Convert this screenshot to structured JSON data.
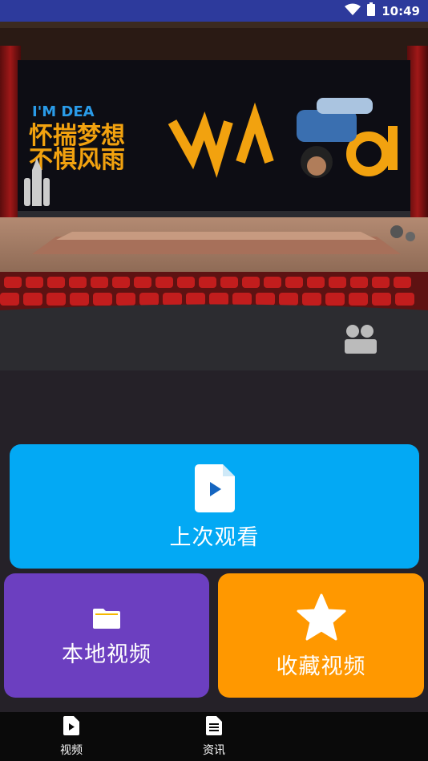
{
  "status_bar": {
    "time": "10:49"
  },
  "banner": {
    "headline_en": "I'M DEA",
    "headline_cn_line1": "怀揣梦想",
    "headline_cn_line2": "不惧风雨"
  },
  "cards": {
    "last_watched": {
      "label": "上次观看",
      "icon": "video-file-icon",
      "color": "#03a9f4"
    },
    "local_video": {
      "label": "本地视频",
      "icon": "folder-icon",
      "color": "#6c3fc0"
    },
    "favorite_video": {
      "label": "收藏视频",
      "icon": "star-icon",
      "color": "#ff9800"
    }
  },
  "bottom_nav": {
    "items": [
      {
        "label": "视频",
        "icon": "video-icon"
      },
      {
        "label": "资讯",
        "icon": "news-icon"
      }
    ]
  }
}
